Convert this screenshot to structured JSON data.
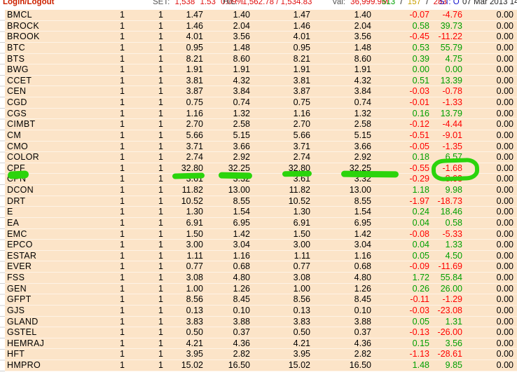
{
  "topbar": {
    "login_label": "Login/Logout",
    "set": {
      "label": "SET:",
      "index": "1,538",
      "change": "1.53",
      "pct": "0.09%"
    },
    "hl": {
      "label": "H/L:",
      "value": "1,562.78 / 1,534.83"
    },
    "val": {
      "label": "Val:",
      "value": "36,999.9M"
    },
    "counts": {
      "up": "513",
      "sep": "/",
      "unchanged": "157",
      "down": "283"
    },
    "status": "ST: O",
    "datetime": "07 Mar 2013 14:"
  },
  "colors": {
    "background": "#fce4c8",
    "positive": "#00a000",
    "negative": "#ff0000",
    "marker": "#2bd40c",
    "login": "#cc2200",
    "status_blue": "#1515cc",
    "value_red": "#e01010"
  },
  "annotation": {
    "marked_row": "CPF",
    "circled_value": "-1.68",
    "underlined_values": [
      "32.80",
      "32.25",
      "32.80",
      "32.25"
    ]
  },
  "table": {
    "rows": [
      {
        "ticker": "BMCL",
        "cells": [
          "1",
          "1",
          "1.47",
          "1.40",
          "1.47",
          "1.40",
          "-0.07",
          "-4.76",
          "0.00"
        ]
      },
      {
        "ticker": "BROCK",
        "cells": [
          "1",
          "1",
          "1.46",
          "2.04",
          "1.46",
          "2.04",
          "0.58",
          "39.73",
          "0.00"
        ]
      },
      {
        "ticker": "BROOK",
        "cells": [
          "1",
          "1",
          "4.01",
          "3.56",
          "4.01",
          "3.56",
          "-0.45",
          "-11.22",
          "0.00"
        ]
      },
      {
        "ticker": "BTC",
        "cells": [
          "1",
          "1",
          "0.95",
          "1.48",
          "0.95",
          "1.48",
          "0.53",
          "55.79",
          "0.00"
        ]
      },
      {
        "ticker": "BTS",
        "cells": [
          "1",
          "1",
          "8.21",
          "8.60",
          "8.21",
          "8.60",
          "0.39",
          "4.75",
          "0.00"
        ]
      },
      {
        "ticker": "BWG",
        "cells": [
          "1",
          "1",
          "1.91",
          "1.91",
          "1.91",
          "1.91",
          "0.00",
          "0.00",
          "0.00"
        ]
      },
      {
        "ticker": "CCET",
        "cells": [
          "1",
          "1",
          "3.81",
          "4.32",
          "3.81",
          "4.32",
          "0.51",
          "13.39",
          "0.00"
        ]
      },
      {
        "ticker": "CEN",
        "cells": [
          "1",
          "1",
          "3.87",
          "3.84",
          "3.87",
          "3.84",
          "-0.03",
          "-0.78",
          "0.00"
        ]
      },
      {
        "ticker": "CGD",
        "cells": [
          "1",
          "1",
          "0.75",
          "0.74",
          "0.75",
          "0.74",
          "-0.01",
          "-1.33",
          "0.00"
        ]
      },
      {
        "ticker": "CGS",
        "cells": [
          "1",
          "1",
          "1.16",
          "1.32",
          "1.16",
          "1.32",
          "0.16",
          "13.79",
          "0.00"
        ]
      },
      {
        "ticker": "CIMBT",
        "cells": [
          "1",
          "1",
          "2.70",
          "2.58",
          "2.70",
          "2.58",
          "-0.12",
          "-4.44",
          "0.00"
        ]
      },
      {
        "ticker": "CM",
        "cells": [
          "1",
          "1",
          "5.66",
          "5.15",
          "5.66",
          "5.15",
          "-0.51",
          "-9.01",
          "0.00"
        ]
      },
      {
        "ticker": "CMO",
        "cells": [
          "1",
          "1",
          "3.71",
          "3.66",
          "3.71",
          "3.66",
          "-0.05",
          "-1.35",
          "0.00"
        ]
      },
      {
        "ticker": "COLOR",
        "cells": [
          "1",
          "1",
          "2.74",
          "2.92",
          "2.74",
          "2.92",
          "0.18",
          "6.57",
          "0.00"
        ]
      },
      {
        "ticker": "CPF",
        "cells": [
          "1",
          "1",
          "32.80",
          "32.25",
          "32.80",
          "32.25",
          "-0.55",
          "-1.68",
          "0.00"
        ]
      },
      {
        "ticker": "CPN",
        "cells": [
          "1",
          "1",
          "3.61",
          "3.32",
          "3.61",
          "3.32",
          "-0.29",
          "-8.03",
          "0.00"
        ]
      },
      {
        "ticker": "DCON",
        "cells": [
          "1",
          "1",
          "11.82",
          "13.00",
          "11.82",
          "13.00",
          "1.18",
          "9.98",
          "0.00"
        ]
      },
      {
        "ticker": "DRT",
        "cells": [
          "1",
          "1",
          "10.52",
          "8.55",
          "10.52",
          "8.55",
          "-1.97",
          "-18.73",
          "0.00"
        ]
      },
      {
        "ticker": "E",
        "cells": [
          "1",
          "1",
          "1.30",
          "1.54",
          "1.30",
          "1.54",
          "0.24",
          "18.46",
          "0.00"
        ]
      },
      {
        "ticker": "EA",
        "cells": [
          "1",
          "1",
          "6.91",
          "6.95",
          "6.91",
          "6.95",
          "0.04",
          "0.58",
          "0.00"
        ]
      },
      {
        "ticker": "EMC",
        "cells": [
          "1",
          "1",
          "1.50",
          "1.42",
          "1.50",
          "1.42",
          "-0.08",
          "-5.33",
          "0.00"
        ]
      },
      {
        "ticker": "EPCO",
        "cells": [
          "1",
          "1",
          "3.00",
          "3.04",
          "3.00",
          "3.04",
          "0.04",
          "1.33",
          "0.00"
        ]
      },
      {
        "ticker": "ESTAR",
        "cells": [
          "1",
          "1",
          "1.11",
          "1.16",
          "1.11",
          "1.16",
          "0.05",
          "4.50",
          "0.00"
        ]
      },
      {
        "ticker": "EVER",
        "cells": [
          "1",
          "1",
          "0.77",
          "0.68",
          "0.77",
          "0.68",
          "-0.09",
          "-11.69",
          "0.00"
        ]
      },
      {
        "ticker": "FSS",
        "cells": [
          "1",
          "1",
          "3.08",
          "4.80",
          "3.08",
          "4.80",
          "1.72",
          "55.84",
          "0.00"
        ]
      },
      {
        "ticker": "GEN",
        "cells": [
          "1",
          "1",
          "1.00",
          "1.26",
          "1.00",
          "1.26",
          "0.26",
          "26.00",
          "0.00"
        ]
      },
      {
        "ticker": "GFPT",
        "cells": [
          "1",
          "1",
          "8.56",
          "8.45",
          "8.56",
          "8.45",
          "-0.11",
          "-1.29",
          "0.00"
        ]
      },
      {
        "ticker": "GJS",
        "cells": [
          "1",
          "1",
          "0.13",
          "0.10",
          "0.13",
          "0.10",
          "-0.03",
          "-23.08",
          "0.00"
        ]
      },
      {
        "ticker": "GLAND",
        "cells": [
          "1",
          "1",
          "3.83",
          "3.88",
          "3.83",
          "3.88",
          "0.05",
          "1.31",
          "0.00"
        ]
      },
      {
        "ticker": "GSTEL",
        "cells": [
          "1",
          "1",
          "0.50",
          "0.37",
          "0.50",
          "0.37",
          "-0.13",
          "-26.00",
          "0.00"
        ]
      },
      {
        "ticker": "HEMRAJ",
        "cells": [
          "1",
          "1",
          "4.21",
          "4.36",
          "4.21",
          "4.36",
          "0.15",
          "3.56",
          "0.00"
        ]
      },
      {
        "ticker": "HFT",
        "cells": [
          "1",
          "1",
          "3.95",
          "2.82",
          "3.95",
          "2.82",
          "-1.13",
          "-28.61",
          "0.00"
        ]
      },
      {
        "ticker": "HMPRO",
        "cells": [
          "1",
          "1",
          "15.02",
          "16.50",
          "15.02",
          "16.50",
          "1.48",
          "9.85",
          "0.00"
        ]
      }
    ]
  }
}
